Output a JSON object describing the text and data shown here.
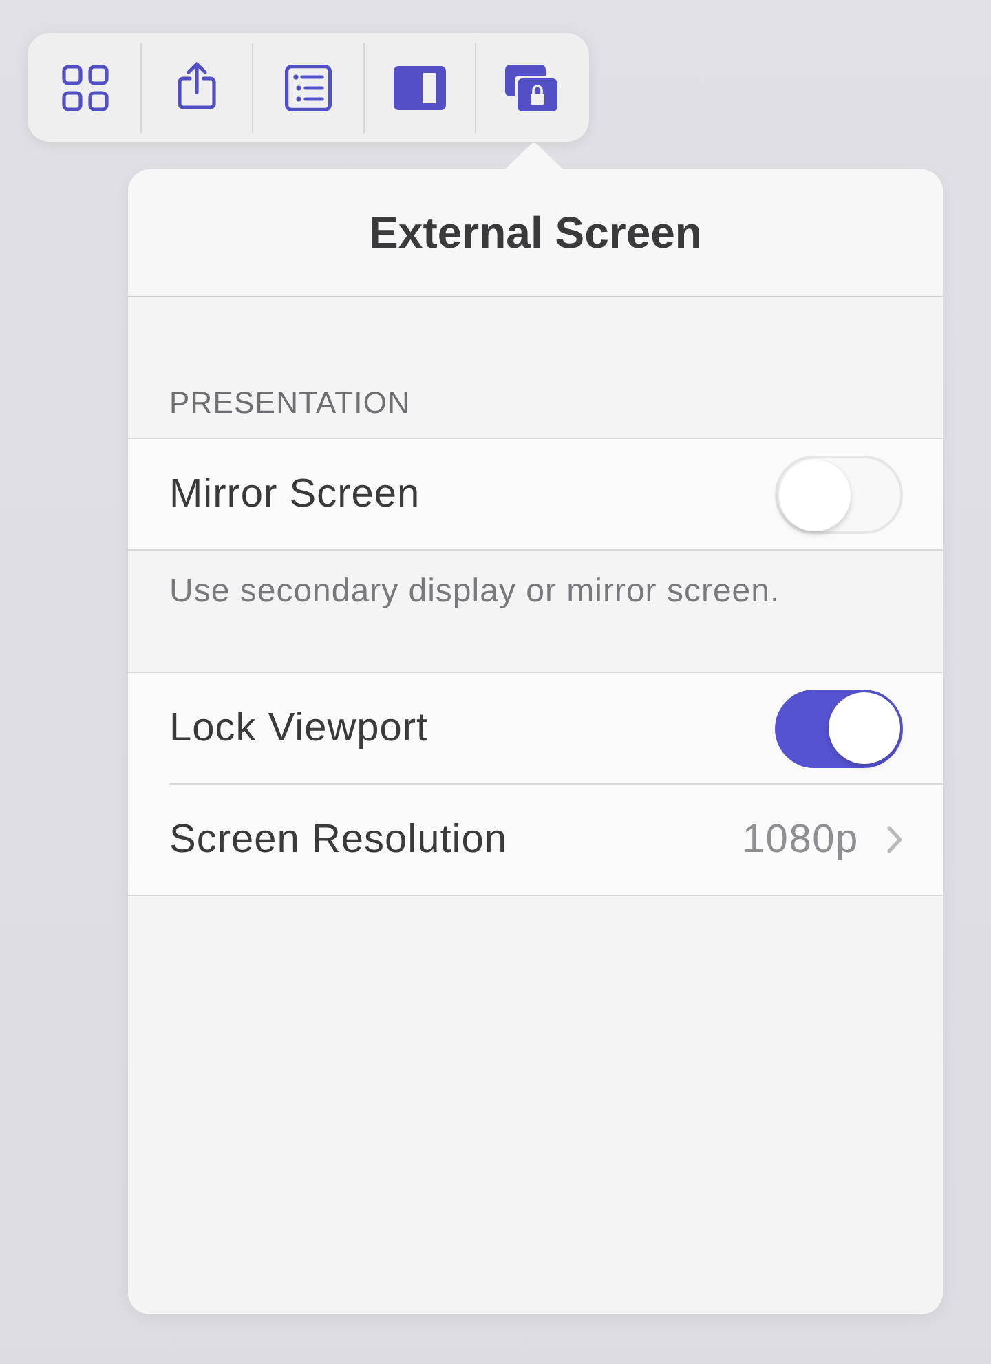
{
  "popover": {
    "title": "External Screen"
  },
  "sections": [
    {
      "header": "PRESENTATION",
      "rows": [
        {
          "kind": "toggle",
          "label": "Mirror Screen",
          "on": false
        }
      ],
      "footer": "Use secondary display or mirror screen."
    },
    {
      "rows": [
        {
          "kind": "toggle",
          "label": "Lock Viewport",
          "on": true
        },
        {
          "kind": "disclosure",
          "label": "Screen Resolution",
          "value": "1080p"
        }
      ]
    }
  ]
}
